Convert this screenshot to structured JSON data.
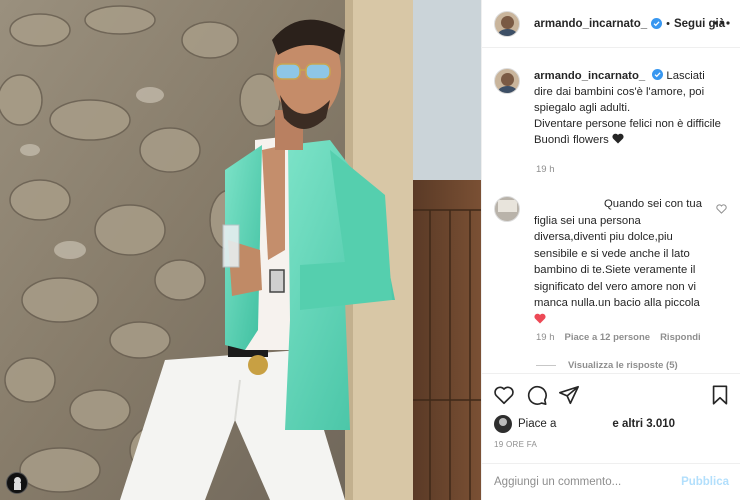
{
  "post": {
    "username": "armando_incarnato_",
    "separator": "•",
    "follow_label": "Segui già",
    "caption": "Lasciati dire dai bambini cos'è l'amore, poi spiegalo agli adulti.",
    "caption_line2": "Diventare persone felici non è difficile",
    "caption_line3": "Buondì flowers",
    "caption_time": "19 h"
  },
  "comment": {
    "text_lead": "Quando sei con",
    "text_rest": "tua figlia sei una persona diversa,diventi piu dolce,piu sensibile e si vede anche il lato bambino di te.Siete veramente il significato del vero amore non vi manca nulla.un bacio alla piccola",
    "time": "19 h",
    "likes": "Piace a 12 persone",
    "reply_label": "Rispondi",
    "view_replies": "Visualizza le risposte (5)"
  },
  "likes": {
    "prefix": "Piace a",
    "suffix": "e altri 3.010"
  },
  "post_time": "19 ORE FA",
  "comment_bar": {
    "placeholder": "Aggiungi un commento...",
    "publish_label": "Pubblica"
  },
  "icons": {
    "verified": "verified-badge-icon",
    "more": "more-options-icon",
    "like": "heart-icon",
    "comment": "comment-bubble-icon",
    "share": "paper-plane-icon",
    "save": "bookmark-icon"
  },
  "colors": {
    "verified": "#3897f0",
    "publish_disabled": "#b2dffc",
    "red_heart": "#ed4956",
    "jacket": "#5fd6b8"
  }
}
